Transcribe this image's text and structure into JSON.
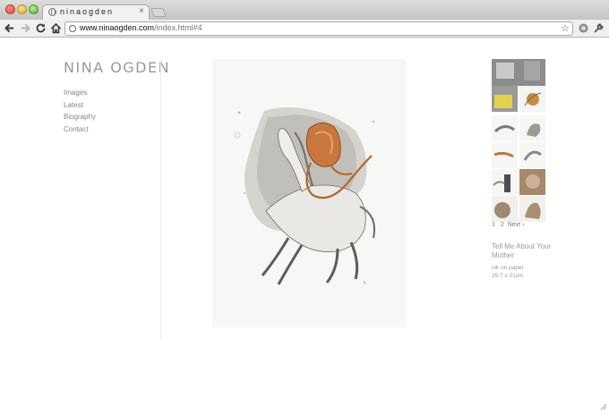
{
  "browser": {
    "tab_title": "ninaogden",
    "tab_close": "×",
    "url_domain": "www.ninaogden.com",
    "url_path": "/index.html#4",
    "icons": {
      "back": "back-arrow-icon",
      "forward": "forward-arrow-icon",
      "reload": "reload-icon",
      "home": "home-icon",
      "bookmark": "star-icon",
      "extension": "extension-icon",
      "settings": "wrench-icon"
    }
  },
  "site": {
    "title": "NINA OGDEN",
    "nav": [
      "Images",
      "Latest",
      "Biography",
      "Contact"
    ]
  },
  "gallery": {
    "pager": {
      "page1": "1",
      "page2": "2",
      "next": "Next ›"
    },
    "artwork_title": "Tell Me About Your Mother",
    "medium": "ink on paper",
    "size": "29.7 x 21cm"
  }
}
